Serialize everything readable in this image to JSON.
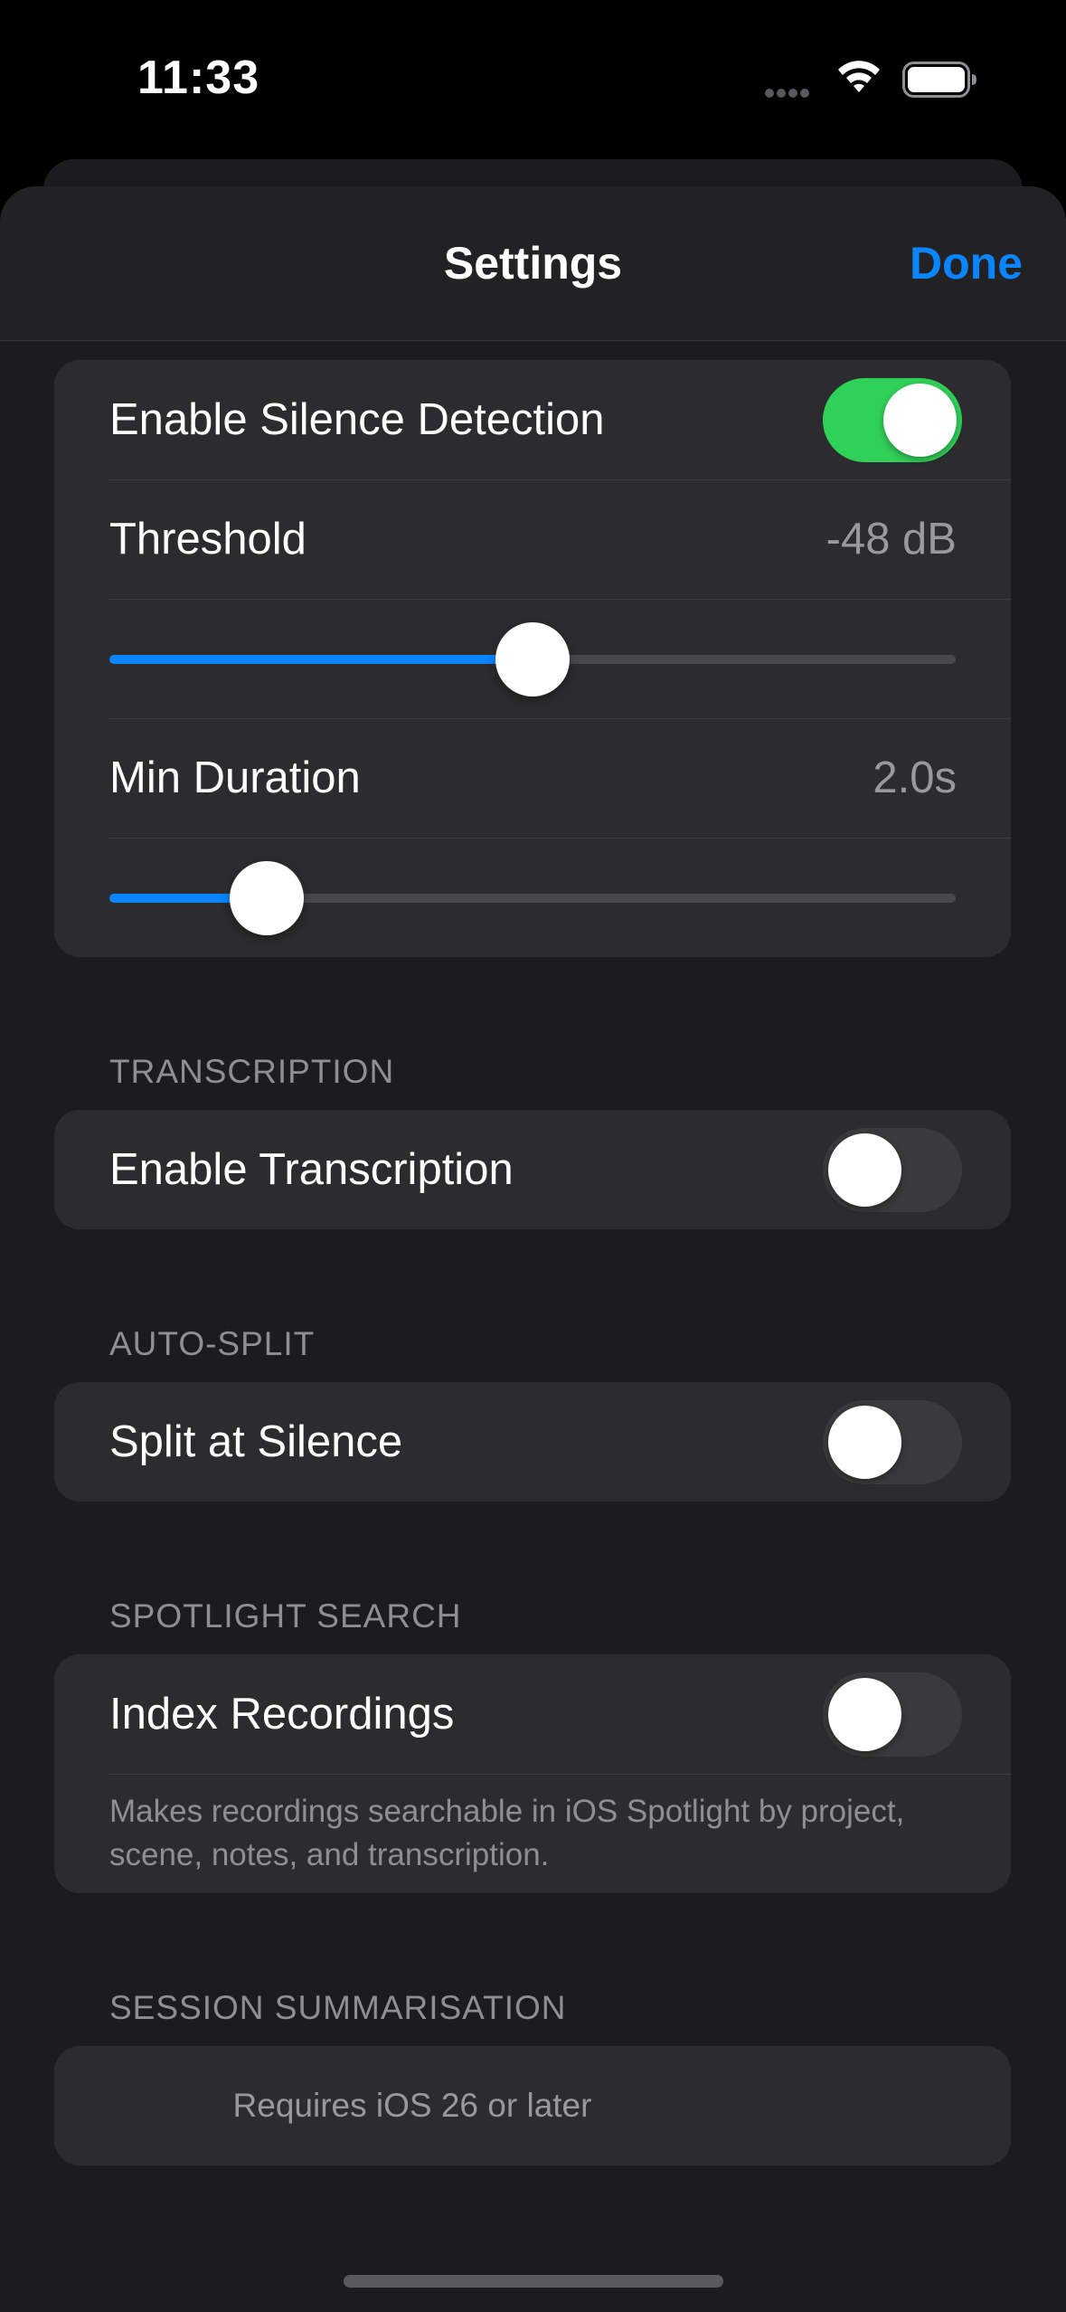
{
  "status_bar": {
    "time": "11:33",
    "icons": [
      "cellular-dots-icon",
      "wifi-icon",
      "battery-icon"
    ]
  },
  "nav": {
    "title": "Settings",
    "done_label": "Done"
  },
  "colors": {
    "accent": "#0a84ff",
    "toggle_on": "#30d158",
    "toggle_off": "#3a3a3c",
    "background": "#1c1c1e",
    "cell": "#2c2c2e",
    "secondary_text": "#8e8e93"
  },
  "silence_detection": {
    "enable_label": "Enable Silence Detection",
    "enabled": true,
    "threshold_label": "Threshold",
    "threshold_value": "-48 dB",
    "threshold_fraction": 0.5,
    "min_duration_label": "Min Duration",
    "min_duration_value": "2.0s",
    "min_duration_fraction": 0.186
  },
  "transcription": {
    "header": "TRANSCRIPTION",
    "enable_label": "Enable Transcription",
    "enabled": false
  },
  "auto_split": {
    "header": "AUTO-SPLIT",
    "split_label": "Split at Silence",
    "enabled": false
  },
  "spotlight": {
    "header": "SPOTLIGHT SEARCH",
    "index_label": "Index Recordings",
    "enabled": false,
    "footnote": "Makes recordings searchable in iOS Spotlight by project, scene, notes, and transcription."
  },
  "summarisation": {
    "header": "SESSION SUMMARISATION",
    "requires_text": "Requires iOS 26 or later"
  }
}
